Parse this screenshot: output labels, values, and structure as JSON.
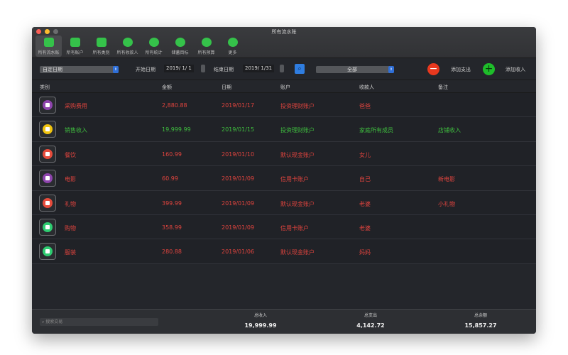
{
  "window": {
    "title": "所有流水账"
  },
  "toolbar": [
    {
      "label": "所有流水账"
    },
    {
      "label": "所有账户"
    },
    {
      "label": "所有类别"
    },
    {
      "label": "所有收款人"
    },
    {
      "label": "所有统计"
    },
    {
      "label": "储蓄目标"
    },
    {
      "label": "所有预算"
    },
    {
      "label": "更多"
    }
  ],
  "filter": {
    "range": "自定日期",
    "start_label": "开始日期",
    "start": "2019/  1/  1",
    "end_label": "结束日期",
    "end": "2019/  1/31",
    "search_icon": "⌕",
    "scope": "全部",
    "add_expense": "添加支出",
    "add_income": "添加收入",
    "minus": "−",
    "plus": "+"
  },
  "columns": [
    "类别",
    "金额",
    "日期",
    "账户",
    "收款人",
    "备注"
  ],
  "rows": [
    {
      "category": "采购费用",
      "amount": "2,880.88",
      "date": "2019/01/17",
      "account": "投资理财账户",
      "payee": "爸爸",
      "note": "",
      "type": "expense",
      "icon": "tag-icon",
      "color": "#8e44ad"
    },
    {
      "category": "销售收入",
      "amount": "19,999.99",
      "date": "2019/01/15",
      "account": "投资理财账户",
      "payee": "家庭所有成员",
      "note": "店铺收入",
      "type": "income",
      "icon": "wallet-icon",
      "color": "#f1c40f"
    },
    {
      "category": "餐饮",
      "amount": "160.99",
      "date": "2019/01/10",
      "account": "默认现金账户",
      "payee": "女儿",
      "note": "",
      "type": "expense",
      "icon": "dining-icon",
      "color": "#e74c3c"
    },
    {
      "category": "电影",
      "amount": "60.99",
      "date": "2019/01/09",
      "account": "信用卡账户",
      "payee": "自己",
      "note": "新电影",
      "type": "expense",
      "icon": "film-reel-icon",
      "color": "#8e44ad"
    },
    {
      "category": "礼物",
      "amount": "399.99",
      "date": "2019/01/09",
      "account": "默认现金账户",
      "payee": "老婆",
      "note": "小礼物",
      "type": "expense",
      "icon": "gift-icon",
      "color": "#e74c3c"
    },
    {
      "category": "购物",
      "amount": "358.99",
      "date": "2019/01/09",
      "account": "信用卡账户",
      "payee": "老婆",
      "note": "",
      "type": "expense",
      "icon": "shopping-bag-icon",
      "color": "#2ecc71"
    },
    {
      "category": "服装",
      "amount": "280.88",
      "date": "2019/01/06",
      "account": "默认现金账户",
      "payee": "妈妈",
      "note": "",
      "type": "expense",
      "icon": "tshirt-icon",
      "color": "#2ecc71"
    }
  ],
  "footer": {
    "search_placeholder": "搜索交易",
    "income_label": "总收入",
    "income": "19,999.99",
    "expense_label": "总支出",
    "expense": "4,142.72",
    "balance_label": "总余额",
    "balance": "15,857.27"
  },
  "colors": {
    "expense": "#e0443e",
    "income": "#3fbf3f"
  }
}
